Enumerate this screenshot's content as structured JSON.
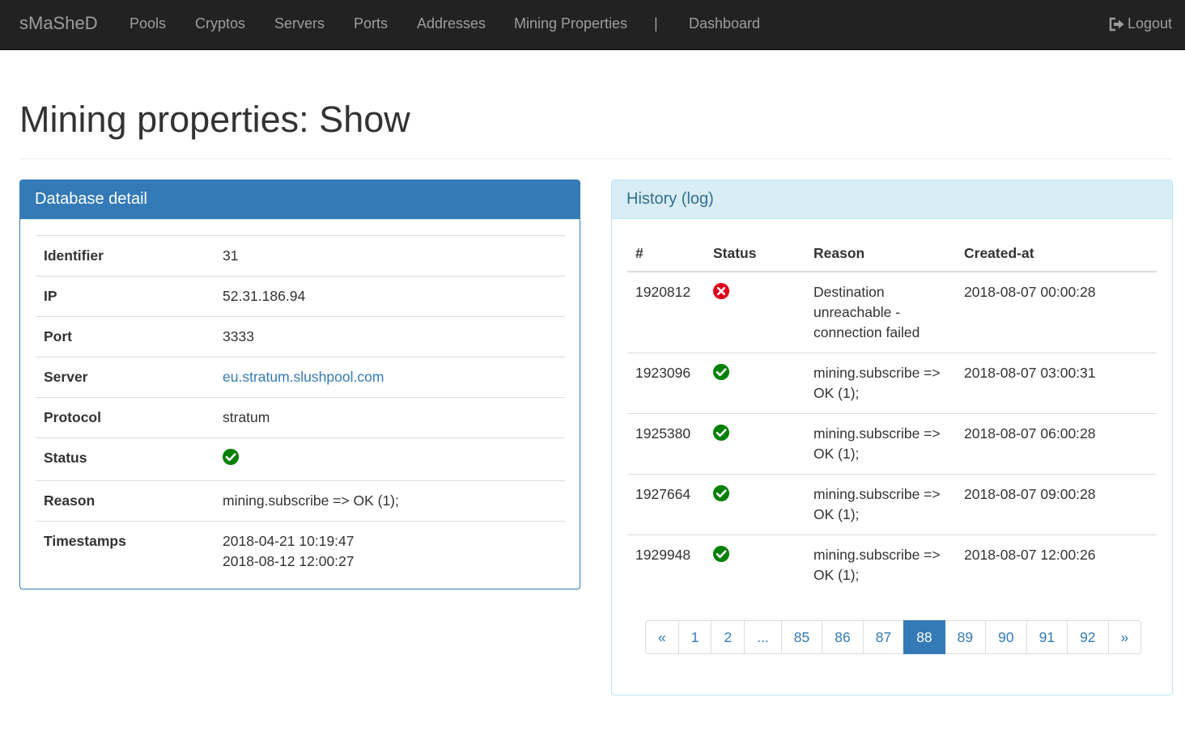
{
  "navbar": {
    "brand": "sMaSheD",
    "items": [
      "Pools",
      "Cryptos",
      "Servers",
      "Ports",
      "Addresses",
      "Mining Properties",
      "|",
      "Dashboard"
    ],
    "logout": "Logout"
  },
  "page": {
    "title": "Mining properties: Show"
  },
  "detail": {
    "heading": "Database detail",
    "rows": [
      {
        "key": "Identifier",
        "value": "31"
      },
      {
        "key": "IP",
        "value": "52.31.186.94"
      },
      {
        "key": "Port",
        "value": "3333"
      },
      {
        "key": "Server",
        "value": "eu.stratum.slushpool.com"
      },
      {
        "key": "Protocol",
        "value": "stratum"
      },
      {
        "key": "Status",
        "value": "ok-icon"
      },
      {
        "key": "Reason",
        "value": "mining.subscribe => OK (1);"
      },
      {
        "key": "Timestamps",
        "values": [
          "2018-04-21 10:19:47",
          "2018-08-12 12:00:27"
        ]
      }
    ]
  },
  "history": {
    "heading": "History (log)",
    "columns": [
      "#",
      "Status",
      "Reason",
      "Created-at"
    ],
    "rows": [
      {
        "id": "1920812",
        "status": "error-icon",
        "reason": "Destination unreachable - connection failed",
        "created_at": "2018-08-07 00:00:28"
      },
      {
        "id": "1923096",
        "status": "ok-icon",
        "reason": "mining.subscribe => OK (1);",
        "created_at": "2018-08-07 03:00:31"
      },
      {
        "id": "1925380",
        "status": "ok-icon",
        "reason": "mining.subscribe => OK (1);",
        "created_at": "2018-08-07 06:00:28"
      },
      {
        "id": "1927664",
        "status": "ok-icon",
        "reason": "mining.subscribe => OK (1);",
        "created_at": "2018-08-07 09:00:28"
      },
      {
        "id": "1929948",
        "status": "ok-icon",
        "reason": "mining.subscribe => OK (1);",
        "created_at": "2018-08-07 12:00:26"
      }
    ],
    "pagination": {
      "prev": "«",
      "pages": [
        "1",
        "2",
        "...",
        "85",
        "86",
        "87",
        "88",
        "89",
        "90",
        "91",
        "92"
      ],
      "active": "88",
      "next": "»"
    }
  },
  "colors": {
    "navbar": "#222222",
    "primary": "#337ab7",
    "info_bg": "#d9edf7",
    "ok": "#008000",
    "error": "#e0001b"
  }
}
